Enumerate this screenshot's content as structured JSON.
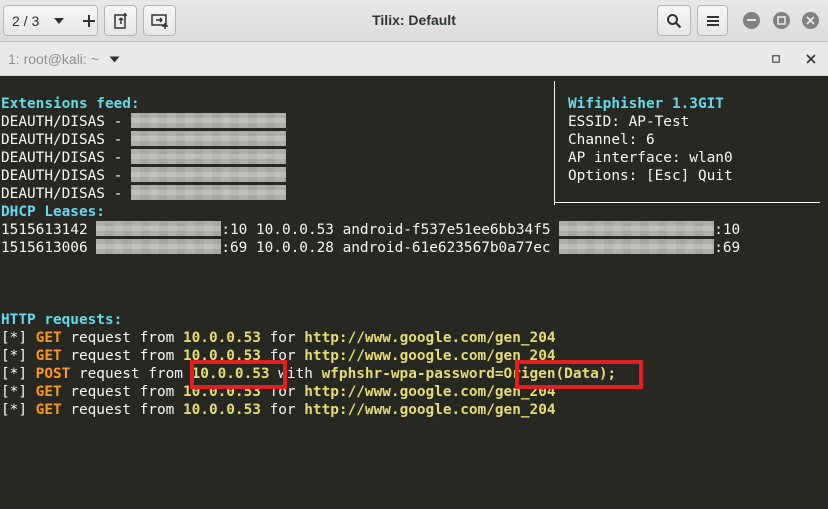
{
  "header": {
    "session_count": "2 / 3",
    "title": "Tilix: Default"
  },
  "terminal_bar": {
    "title": "1: root@kali: ~"
  },
  "terminal": {
    "extensions_header": "Extensions feed:",
    "deauth_label": "DEAUTH/DISAS - ",
    "deauth_count": 5,
    "info_title": "Wifiphisher 1.3GIT",
    "essid": "ESSID: AP-Test",
    "channel": "Channel: 6",
    "ap_interface": "AP interface: wlan0",
    "options": "Options: [Esc] Quit",
    "dhcp_header": "DHCP Leases:",
    "dhcp": [
      {
        "ts": "1515613142 ",
        "suffix1": ":10 10.0.0.53 android-f537e51ee6bb34f5 ",
        "suffix2": ":10"
      },
      {
        "ts": "1515613006 ",
        "suffix1": ":69 10.0.0.28 android-61e623567b0a77ec ",
        "suffix2": ":69"
      }
    ],
    "http_header": "HTTP requests:",
    "requests": [
      {
        "prefix": "[*] ",
        "method": "GET",
        "mid": " request from ",
        "ip": "10.0.0.53",
        "mid2": " for ",
        "target": "http://www.google.com/gen_204"
      },
      {
        "prefix": "[*] ",
        "method": "GET",
        "mid": " request from ",
        "ip": "10.0.0.53",
        "mid2": " for ",
        "target": "http://www.google.com/gen_204"
      },
      {
        "prefix": "[*] ",
        "method": "POST",
        "mid": " request from ",
        "ip": "10.0.0.53",
        "mid2": " with ",
        "target": "wfphshr-wpa-password=Origen(Data);"
      },
      {
        "prefix": "[*] ",
        "method": "GET",
        "mid": " request from ",
        "ip": "10.0.0.53",
        "mid2": " for ",
        "target": "http://www.google.com/gen_204"
      },
      {
        "prefix": "[*] ",
        "method": "GET",
        "mid": " request from ",
        "ip": "10.0.0.53",
        "mid2": " for ",
        "target": "http://www.google.com/gen_204"
      }
    ]
  },
  "colors": {
    "terminal_bg": "#272822",
    "cyan": "#66d9ef",
    "yellow": "#e6db74",
    "orange": "#fd971f",
    "highlight_box": "#e41e1e"
  },
  "icons": {
    "session_dropdown": "chevron-down-icon",
    "add_session": "plus-icon",
    "add_terminal_right": "split-right-icon",
    "add_terminal_down": "split-down-icon",
    "search": "search-icon",
    "menu": "hamburger-menu-icon",
    "minimize": "minimize-icon",
    "maximize": "maximize-icon",
    "close": "close-icon",
    "terminal_menu": "chevron-down-icon",
    "terminal_maximize": "maximize-icon",
    "terminal_close": "close-icon"
  }
}
